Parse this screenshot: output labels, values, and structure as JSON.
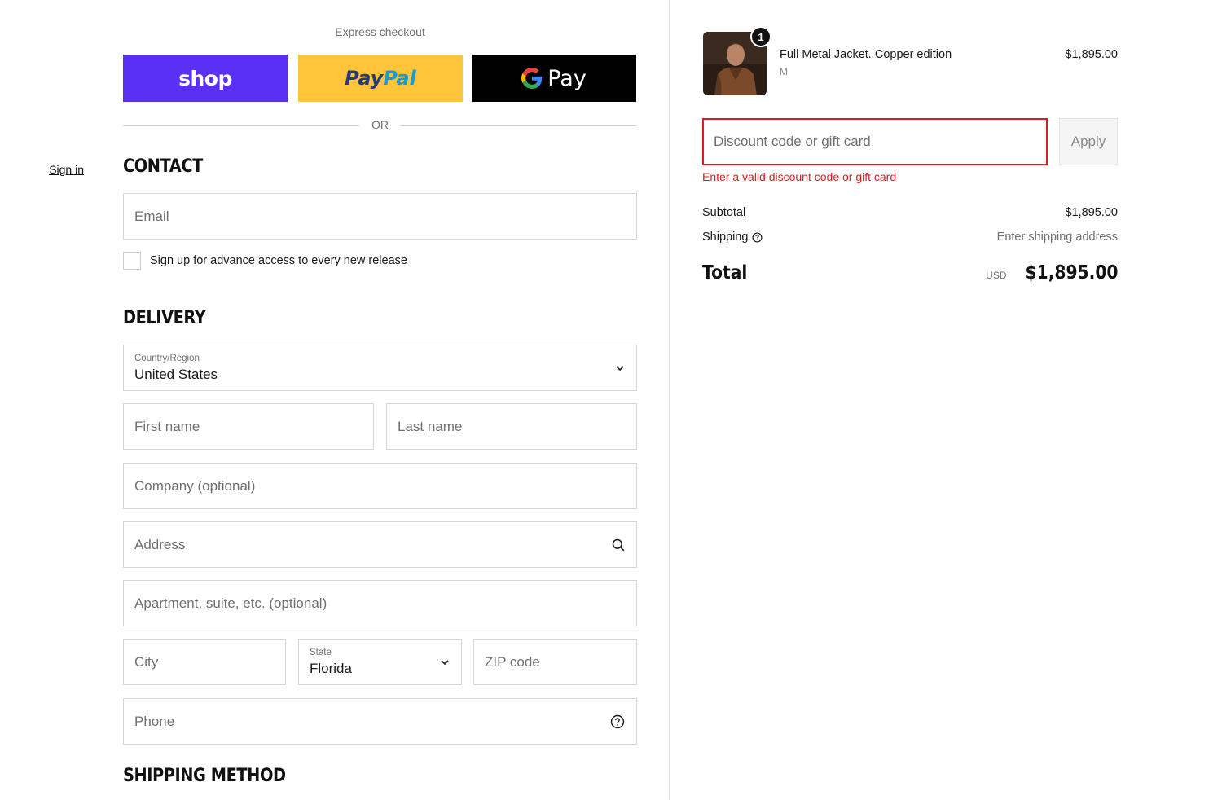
{
  "express": {
    "title": "Express checkout",
    "shop_label": "shop",
    "paypal_part1": "Pay",
    "paypal_part2": "Pal",
    "gpay_label": "Pay",
    "or_text": "OR"
  },
  "contact": {
    "title": "CONTACT",
    "signin_label": "Sign in",
    "email_placeholder": "Email",
    "newsletter_label": "Sign up for advance access to every new release"
  },
  "delivery": {
    "title": "DELIVERY",
    "country_label": "Country/Region",
    "country_value": "United States",
    "first_name_placeholder": "First name",
    "last_name_placeholder": "Last name",
    "company_placeholder": "Company (optional)",
    "address_placeholder": "Address",
    "apartment_placeholder": "Apartment, suite, etc. (optional)",
    "city_placeholder": "City",
    "state_label": "State",
    "state_value": "Florida",
    "zip_placeholder": "ZIP code",
    "phone_placeholder": "Phone"
  },
  "shipping_method": {
    "title": "SHIPPING METHOD"
  },
  "cart": {
    "item": {
      "quantity": "1",
      "name": "Full Metal Jacket. Copper edition",
      "variant": "M",
      "price": "$1,895.00"
    },
    "discount_placeholder": "Discount code or gift card",
    "apply_label": "Apply",
    "discount_error": "Enter a valid discount code or gift card",
    "subtotal_label": "Subtotal",
    "subtotal_value": "$1,895.00",
    "shipping_label": "Shipping",
    "shipping_value": "Enter shipping address",
    "total_label": "Total",
    "currency": "USD",
    "total_value": "$1,895.00"
  },
  "colors": {
    "shop_purple": "#5a31f4",
    "paypal_yellow": "#ffc439",
    "gpay_black": "#000000",
    "error_red": "#dd1d1d"
  }
}
